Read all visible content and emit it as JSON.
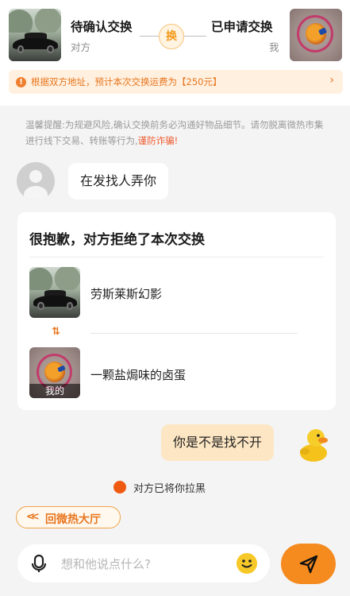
{
  "header": {
    "left": {
      "status": "待确认交换",
      "role": "对方"
    },
    "swap_label": "换",
    "right": {
      "status": "已申请交换",
      "role": "我"
    },
    "notice": "根据双方地址，预计本次交换运费为【250元】"
  },
  "tips": {
    "text": "温馨提醒:为规避风险,确认交换前务必沟通好物品细节。请勿脱离微热市集进行线下交易、转账等行为,",
    "warning": "谨防诈骗!"
  },
  "messages": {
    "incoming": "在发找人弄你",
    "outgoing": "你是不是找不开"
  },
  "exchange_card": {
    "title": "很抱歉，对方拒绝了本次交换",
    "their_item": "劳斯莱斯幻影",
    "swap_symbol": "⇅",
    "my_item": "一颗盐焗味的卤蛋",
    "mine_tag": "我的"
  },
  "system_message": "对方已将你拉黑",
  "back_button": "回微热大厅",
  "input": {
    "placeholder": "想和他说点什么?"
  },
  "colors": {
    "accent": "#f58a1f",
    "notice_text": "#e8761f",
    "warning": "#f0592d",
    "outgoing_bubble": "#fde6c3"
  },
  "icons": [
    "info-icon",
    "chevron-right-icon",
    "avatar-placeholder-icon",
    "swap-arrows-icon",
    "block-dot-icon",
    "back-arrows-icon",
    "microphone-icon",
    "emoji-icon",
    "send-icon",
    "duck-sticker"
  ]
}
